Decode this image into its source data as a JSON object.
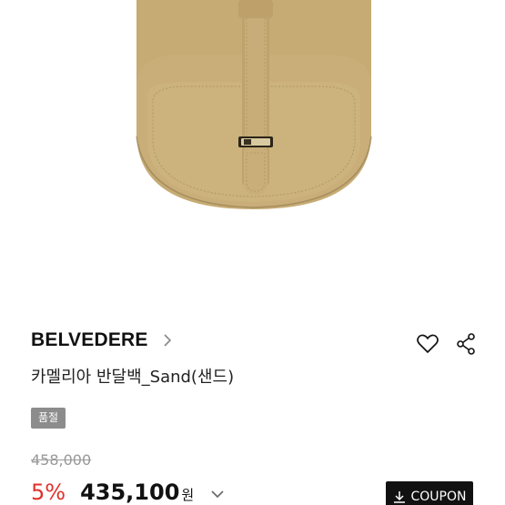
{
  "product": {
    "brand": "BELVEDERE",
    "name": "카멜리아 반달백_Sand(샌드)",
    "status_badge": "품절",
    "original_price": "458,000",
    "discount": "5%",
    "sale_price": "435,100",
    "currency": "원"
  },
  "actions": {
    "wishlist_icon": "heart-icon",
    "share_icon": "share-icon",
    "coupon_label": "COUPON",
    "coupon_icon": "download-icon"
  },
  "colors": {
    "discount": "#e0312c",
    "coupon_bg": "#111111",
    "badge_bg": "#8c8c8c",
    "bag_leather": "#c7ad77"
  }
}
